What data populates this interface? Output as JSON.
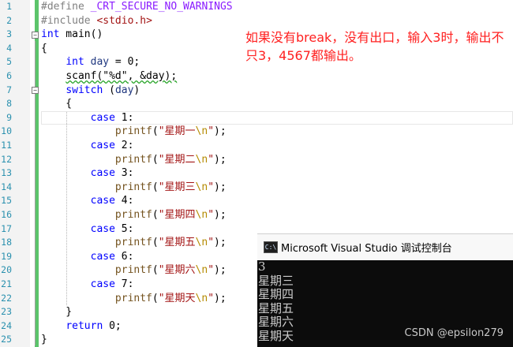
{
  "editor": {
    "line_numbers": [
      "1",
      "2",
      "3",
      "4",
      "5",
      "6",
      "7",
      "8",
      "9",
      "10",
      "11",
      "12",
      "13",
      "14",
      "15",
      "16",
      "17",
      "18",
      "19",
      "20",
      "21",
      "22",
      "23",
      "24",
      "25"
    ],
    "lines": [
      {
        "tokens": [
          {
            "t": "#define ",
            "c": "pp"
          },
          {
            "t": "_CRT_SECURE_NO_WARNINGS",
            "c": "macro"
          }
        ]
      },
      {
        "tokens": [
          {
            "t": "#include ",
            "c": "pp"
          },
          {
            "t": "<stdio.h>",
            "c": "str"
          }
        ]
      },
      {
        "tokens": [
          {
            "t": "int",
            "c": "kw"
          },
          {
            "t": " main()",
            "c": ""
          }
        ]
      },
      {
        "tokens": [
          {
            "t": "{",
            "c": ""
          }
        ]
      },
      {
        "tokens": [
          {
            "t": "    ",
            "c": ""
          },
          {
            "t": "int",
            "c": "kw"
          },
          {
            "t": " ",
            "c": ""
          },
          {
            "t": "day",
            "c": "var"
          },
          {
            "t": " = 0;",
            "c": ""
          }
        ]
      },
      {
        "tokens": [
          {
            "t": "    ",
            "c": ""
          },
          {
            "t": "scanf(\"%d\", &day);",
            "c": "squig"
          }
        ]
      },
      {
        "tokens": [
          {
            "t": "    ",
            "c": ""
          },
          {
            "t": "switch",
            "c": "kw"
          },
          {
            "t": " (",
            "c": ""
          },
          {
            "t": "day",
            "c": "var"
          },
          {
            "t": ")",
            "c": ""
          }
        ]
      },
      {
        "tokens": [
          {
            "t": "    {",
            "c": ""
          }
        ]
      },
      {
        "tokens": [
          {
            "t": "        ",
            "c": ""
          },
          {
            "t": "case",
            "c": "kw"
          },
          {
            "t": " 1:",
            "c": ""
          }
        ]
      },
      {
        "tokens": [
          {
            "t": "            ",
            "c": ""
          },
          {
            "t": "printf",
            "c": "fn"
          },
          {
            "t": "(",
            "c": ""
          },
          {
            "t": "\"星期一",
            "c": "str"
          },
          {
            "t": "\\n",
            "c": "esc"
          },
          {
            "t": "\"",
            "c": "str"
          },
          {
            "t": ");",
            "c": ""
          }
        ]
      },
      {
        "tokens": [
          {
            "t": "        ",
            "c": ""
          },
          {
            "t": "case",
            "c": "kw"
          },
          {
            "t": " 2:",
            "c": ""
          }
        ]
      },
      {
        "tokens": [
          {
            "t": "            ",
            "c": ""
          },
          {
            "t": "printf",
            "c": "fn"
          },
          {
            "t": "(",
            "c": ""
          },
          {
            "t": "\"星期二",
            "c": "str"
          },
          {
            "t": "\\n",
            "c": "esc"
          },
          {
            "t": "\"",
            "c": "str"
          },
          {
            "t": ");",
            "c": ""
          }
        ]
      },
      {
        "tokens": [
          {
            "t": "        ",
            "c": ""
          },
          {
            "t": "case",
            "c": "kw"
          },
          {
            "t": " 3:",
            "c": ""
          }
        ]
      },
      {
        "tokens": [
          {
            "t": "            ",
            "c": ""
          },
          {
            "t": "printf",
            "c": "fn"
          },
          {
            "t": "(",
            "c": ""
          },
          {
            "t": "\"星期三",
            "c": "str"
          },
          {
            "t": "\\n",
            "c": "esc"
          },
          {
            "t": "\"",
            "c": "str"
          },
          {
            "t": ");",
            "c": ""
          }
        ]
      },
      {
        "tokens": [
          {
            "t": "        ",
            "c": ""
          },
          {
            "t": "case",
            "c": "kw"
          },
          {
            "t": " 4:",
            "c": ""
          }
        ]
      },
      {
        "tokens": [
          {
            "t": "            ",
            "c": ""
          },
          {
            "t": "printf",
            "c": "fn"
          },
          {
            "t": "(",
            "c": ""
          },
          {
            "t": "\"星期四",
            "c": "str"
          },
          {
            "t": "\\n",
            "c": "esc"
          },
          {
            "t": "\"",
            "c": "str"
          },
          {
            "t": ");",
            "c": ""
          }
        ]
      },
      {
        "tokens": [
          {
            "t": "        ",
            "c": ""
          },
          {
            "t": "case",
            "c": "kw"
          },
          {
            "t": " 5:",
            "c": ""
          }
        ]
      },
      {
        "tokens": [
          {
            "t": "            ",
            "c": ""
          },
          {
            "t": "printf",
            "c": "fn"
          },
          {
            "t": "(",
            "c": ""
          },
          {
            "t": "\"星期五",
            "c": "str"
          },
          {
            "t": "\\n",
            "c": "esc"
          },
          {
            "t": "\"",
            "c": "str"
          },
          {
            "t": ");",
            "c": ""
          }
        ]
      },
      {
        "tokens": [
          {
            "t": "        ",
            "c": ""
          },
          {
            "t": "case",
            "c": "kw"
          },
          {
            "t": " 6:",
            "c": ""
          }
        ]
      },
      {
        "tokens": [
          {
            "t": "            ",
            "c": ""
          },
          {
            "t": "printf",
            "c": "fn"
          },
          {
            "t": "(",
            "c": ""
          },
          {
            "t": "\"星期六",
            "c": "str"
          },
          {
            "t": "\\n",
            "c": "esc"
          },
          {
            "t": "\"",
            "c": "str"
          },
          {
            "t": ");",
            "c": ""
          }
        ]
      },
      {
        "tokens": [
          {
            "t": "        ",
            "c": ""
          },
          {
            "t": "case",
            "c": "kw"
          },
          {
            "t": " 7:",
            "c": ""
          }
        ]
      },
      {
        "tokens": [
          {
            "t": "            ",
            "c": ""
          },
          {
            "t": "printf",
            "c": "fn"
          },
          {
            "t": "(",
            "c": ""
          },
          {
            "t": "\"星期天",
            "c": "str"
          },
          {
            "t": "\\n",
            "c": "esc"
          },
          {
            "t": "\"",
            "c": "str"
          },
          {
            "t": ");",
            "c": ""
          }
        ]
      },
      {
        "tokens": [
          {
            "t": "    }",
            "c": ""
          }
        ]
      },
      {
        "tokens": [
          {
            "t": "    ",
            "c": ""
          },
          {
            "t": "return",
            "c": "kw"
          },
          {
            "t": " 0;",
            "c": ""
          }
        ]
      },
      {
        "tokens": [
          {
            "t": "}",
            "c": ""
          }
        ]
      }
    ]
  },
  "annotation": {
    "text": "如果没有break，没有出口，输入3时，输出不只3，4567都输出。",
    "color": "#ff2020"
  },
  "console": {
    "title": "Microsoft Visual Studio 调试控制台",
    "icon": "console-app-icon",
    "lines": [
      "3",
      "星期三",
      "星期四",
      "星期五",
      "星期六",
      "星期天"
    ]
  },
  "watermark": "CSDN @epsilon279",
  "colors": {
    "keyword": "#0000ff",
    "string": "#a31515",
    "line_number": "#2b91af",
    "change_bar": "#5cc46b"
  }
}
